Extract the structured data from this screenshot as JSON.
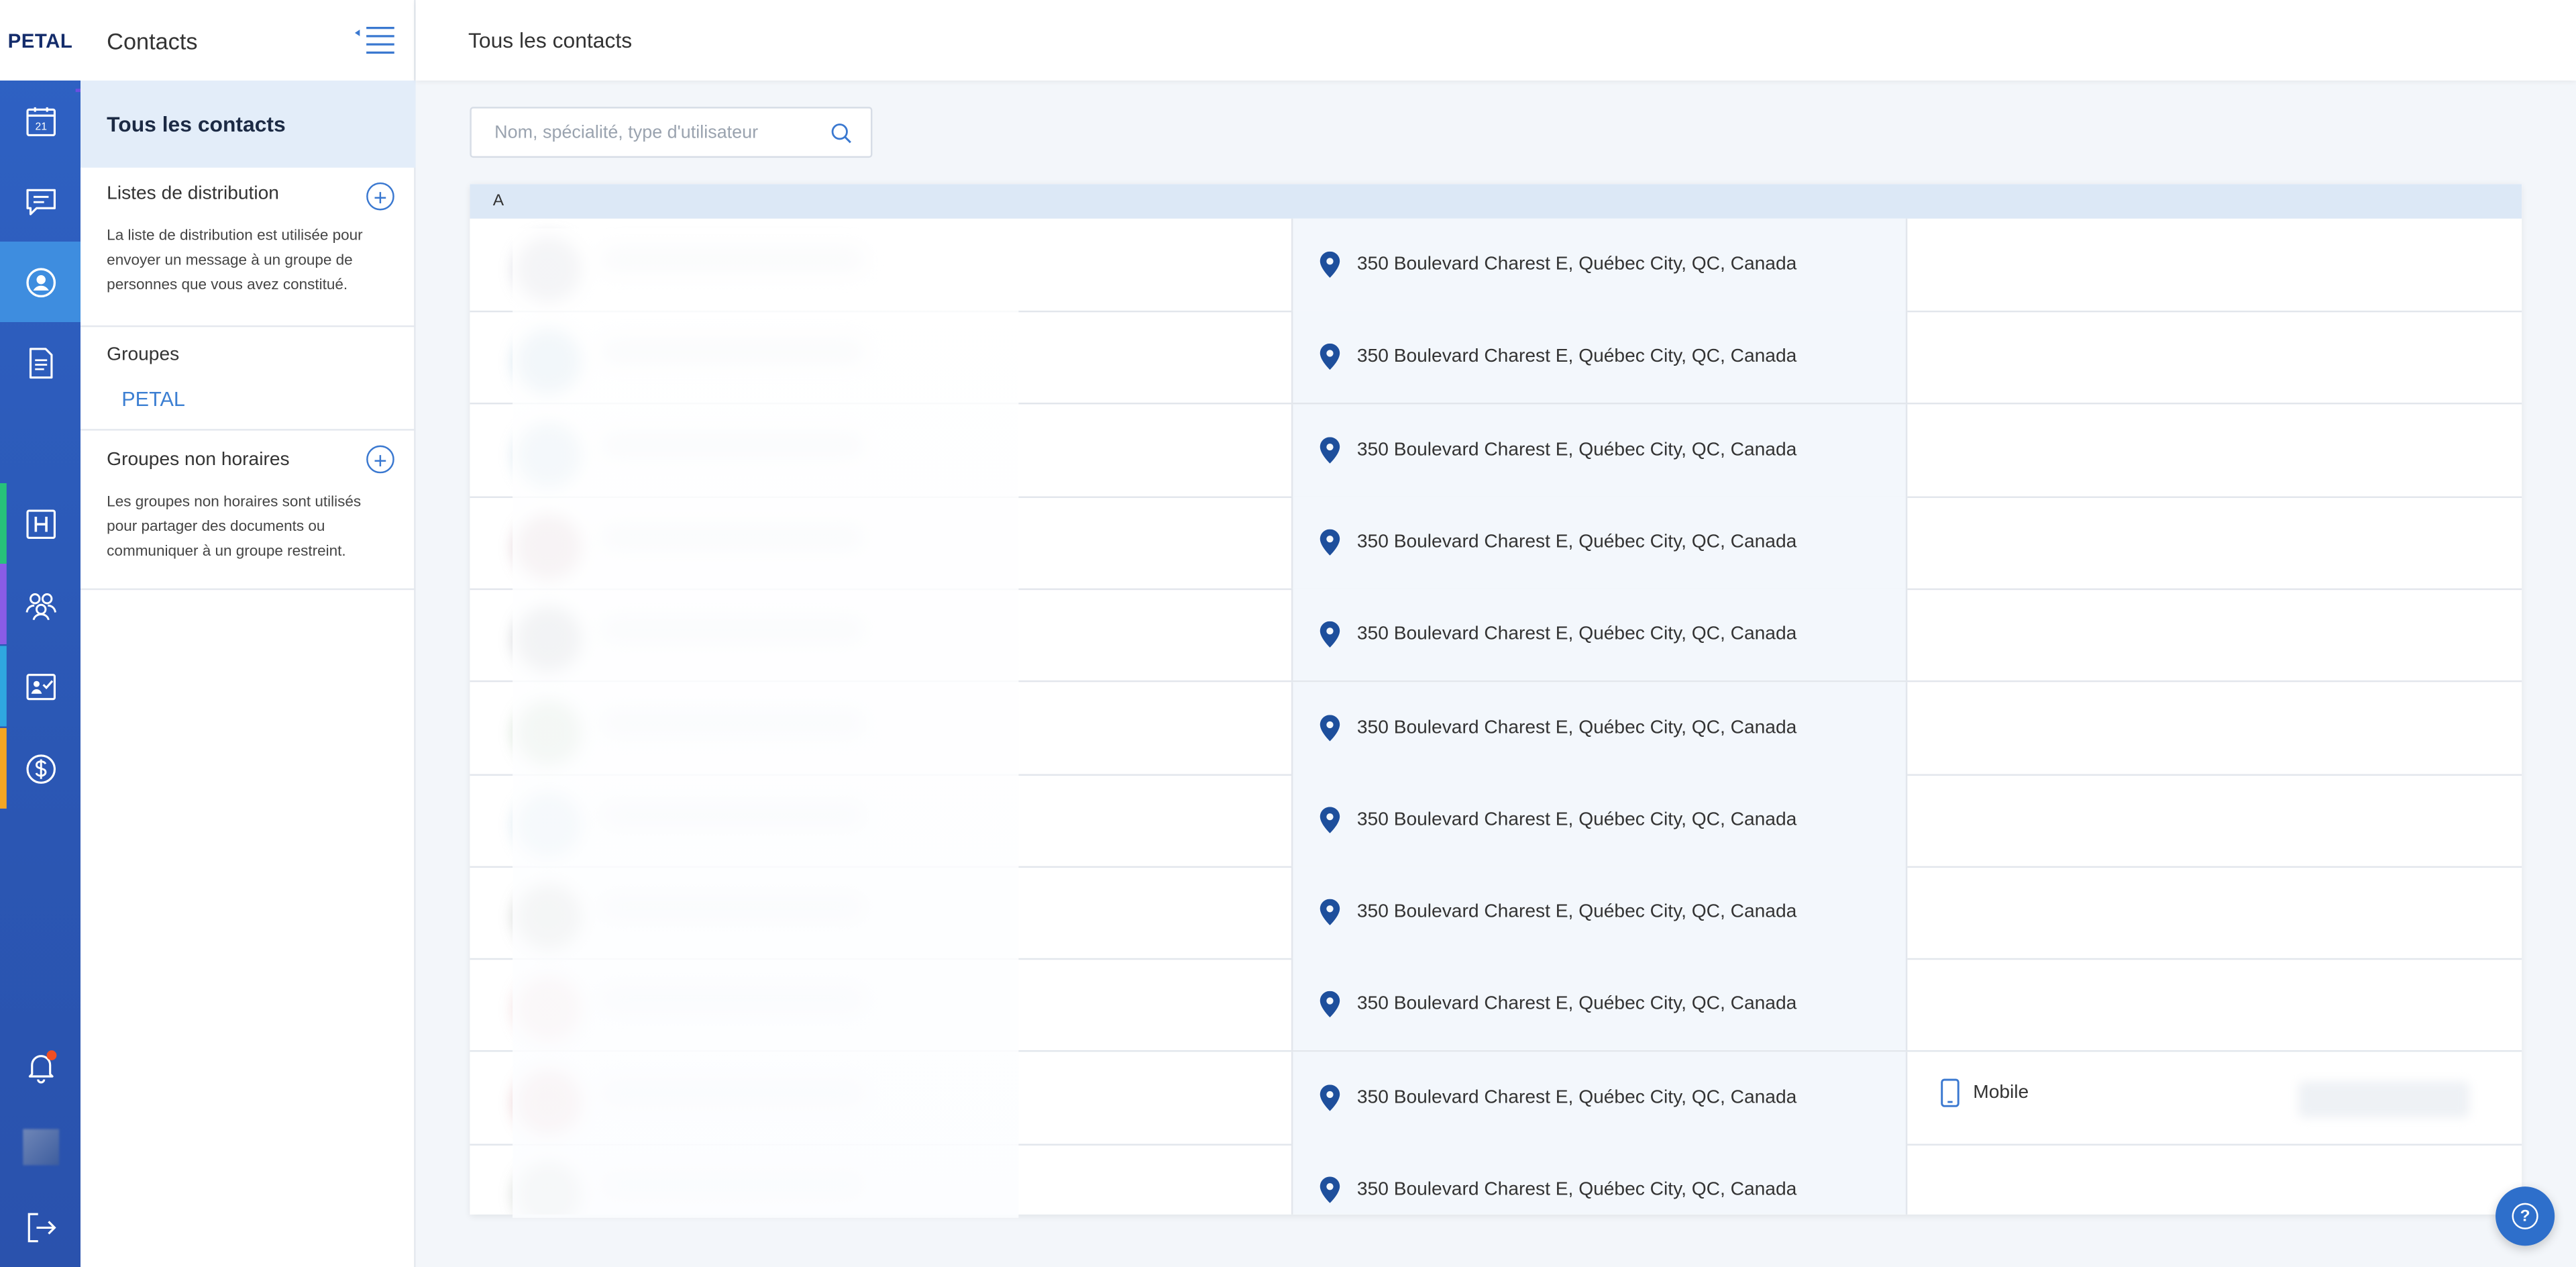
{
  "brand": {
    "logo_text": "PETAL"
  },
  "header": {
    "title": "Tous les contacts"
  },
  "sidebar": {
    "title": "Contacts",
    "all_contacts": "Tous les contacts",
    "distribution": {
      "title": "Listes de distribution",
      "description": "La liste de distribution est utilisée pour envoyer un message à un groupe de personnes que vous avez constitué."
    },
    "groups": {
      "title": "Groupes",
      "items": [
        "PETAL"
      ]
    },
    "non_schedule": {
      "title": "Groupes non horaires",
      "description": "Les groupes non horaires sont utilisés pour partager des documents ou communiquer à un groupe restreint."
    }
  },
  "rail": {
    "calendar_day": "21",
    "items": [
      {
        "name": "calendar-icon",
        "accent": ""
      },
      {
        "name": "chat-icon",
        "accent": ""
      },
      {
        "name": "contacts-icon",
        "accent": "",
        "active": true
      },
      {
        "name": "document-icon",
        "accent": ""
      },
      {
        "name": "hospital-icon",
        "accent": "#27c27a"
      },
      {
        "name": "team-icon",
        "accent": "#8a5ce6"
      },
      {
        "name": "checklist-icon",
        "accent": "#2fa7e0"
      },
      {
        "name": "billing-icon",
        "accent": "#f4a623"
      }
    ]
  },
  "search": {
    "placeholder": "Nom, spécialité, type d'utilisateur",
    "value": ""
  },
  "table": {
    "section_letter": "A",
    "rows": [
      {
        "address": "350 Boulevard Charest E, Québec City, QC, Canada",
        "phone_type": ""
      },
      {
        "address": "350 Boulevard Charest E, Québec City, QC, Canada",
        "phone_type": ""
      },
      {
        "address": "350 Boulevard Charest E, Québec City, QC, Canada",
        "phone_type": ""
      },
      {
        "address": "350 Boulevard Charest E, Québec City, QC, Canada",
        "phone_type": ""
      },
      {
        "address": "350 Boulevard Charest E, Québec City, QC, Canada",
        "phone_type": ""
      },
      {
        "address": "350 Boulevard Charest E, Québec City, QC, Canada",
        "phone_type": ""
      },
      {
        "address": "350 Boulevard Charest E, Québec City, QC, Canada",
        "phone_type": ""
      },
      {
        "address": "350 Boulevard Charest E, Québec City, QC, Canada",
        "phone_type": ""
      },
      {
        "address": "350 Boulevard Charest E, Québec City, QC, Canada",
        "phone_type": ""
      },
      {
        "address": "350 Boulevard Charest E, Québec City, QC, Canada",
        "phone_type": "Mobile"
      },
      {
        "address": "350 Boulevard Charest E, Québec City, QC, Canada",
        "phone_type": ""
      }
    ]
  },
  "colors": {
    "rail": "#2b57b4",
    "active": "#3e8ddf",
    "accent": "#3a78d0",
    "pin": "#1e4f9c",
    "notification": "#f04e23"
  }
}
